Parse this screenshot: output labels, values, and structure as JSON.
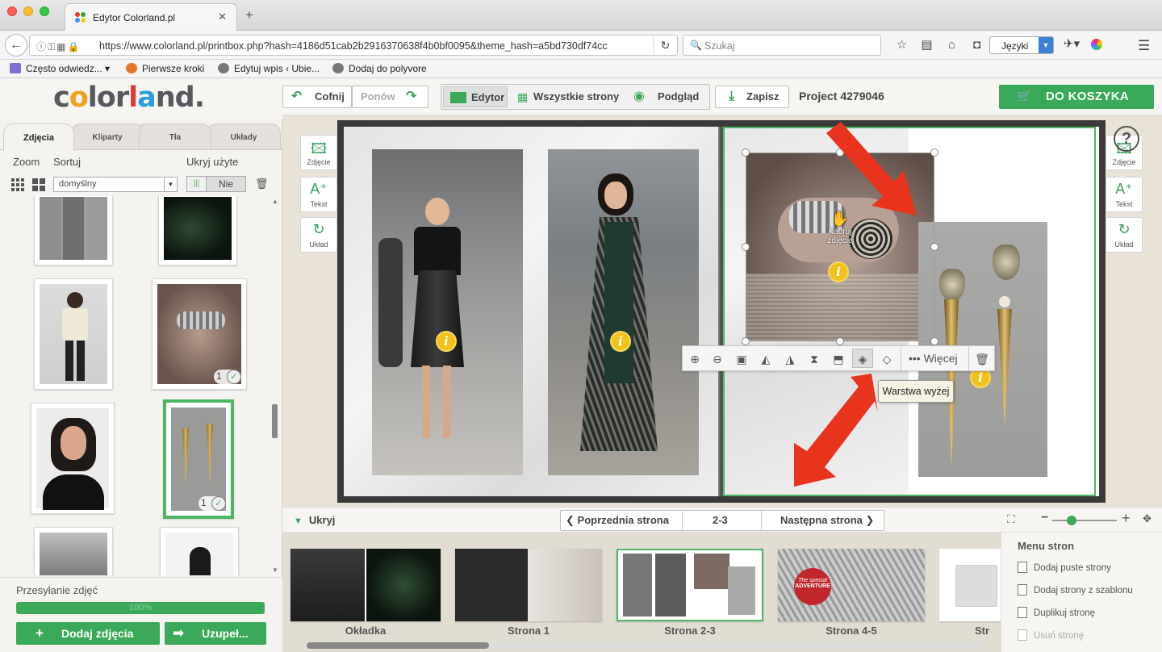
{
  "browser": {
    "tab_title": "Edytor Colorland.pl",
    "tab_close": "✕",
    "new_tab": "+",
    "url": "https://www.colorland.pl/printbox.php?hash=4186d51cab2b2916370638f4b0bf0095&theme_hash=a5bd730df74cc",
    "search_placeholder": "Szukaj",
    "language_select": "Języki",
    "bookmarks": [
      {
        "label": "Często odwiedz...",
        "icon_color": "#7b6fd6",
        "has_arrow": true
      },
      {
        "label": "Pierwsze kroki",
        "icon_color": "#e8742b"
      },
      {
        "label": "Edytuj wpis ‹ Ubie...",
        "icon_color": "#777777"
      },
      {
        "label": "Dodaj do polyvore",
        "icon_color": "#777777"
      }
    ]
  },
  "app": {
    "logo": {
      "part1": "c",
      "part2": "o",
      "part3": "lor",
      "part4": "l",
      "part5": "a",
      "part6": "nd."
    },
    "toolbar": {
      "undo": "Cofnij",
      "redo": "Ponów",
      "editor": "Edytor",
      "all_pages": "Wszystkie strony",
      "preview": "Podgląd",
      "save": "Zapisz",
      "project": "Project 4279046",
      "cart": "DO KOSZYKA"
    },
    "colors": {
      "accent": "#3aa95a",
      "selection": "#4cb665",
      "info": "#f2c21a",
      "arrow": "#e8341c"
    }
  },
  "left_panel": {
    "tabs": [
      "Zdjęcia",
      "Kliparty",
      "Tła",
      "Układy"
    ],
    "zoom_label": "Zoom",
    "sort_label": "Sortuj",
    "hide_used_label": "Ukryj użyte",
    "sort_value": "domyślny",
    "hide_used_value": "Nie",
    "thumbnails": [
      {
        "name": "street-collage",
        "used": null
      },
      {
        "name": "fern-leaves",
        "used": null
      },
      {
        "name": "woman-fringe-top",
        "used": null
      },
      {
        "name": "rings-hand",
        "used": "1"
      },
      {
        "name": "girl-portrait",
        "used": null
      },
      {
        "name": "earrings",
        "used": "1",
        "selected": true
      },
      {
        "name": "street-woman-coat",
        "used": null
      },
      {
        "name": "event-woman",
        "used": null
      }
    ],
    "upload_label": "Przesyłanie zdjęć",
    "upload_progress": 1.0,
    "upload_percent_text": "100%",
    "add_photos": "Dodaj zdjęcia",
    "fill_button": "Uzupeł..."
  },
  "canvas": {
    "left_tools": [
      {
        "name": "add-photo",
        "label": "Zdjęcie"
      },
      {
        "name": "add-text",
        "label": "Tekst"
      },
      {
        "name": "layout",
        "label": "Układ"
      }
    ],
    "right_tools": [
      {
        "name": "add-photo",
        "label": "Zdjęcie"
      },
      {
        "name": "add-text",
        "label": "Tekst"
      },
      {
        "name": "layout",
        "label": "Układ"
      }
    ],
    "help": "?",
    "crop_hint": "Kadruj\nzdjęcie",
    "context_toolbar": {
      "more": "Więcej"
    },
    "tooltip": "Warstwa wyżej"
  },
  "page_nav": {
    "hide": "Ukryj",
    "prev": "Poprzednia strona",
    "current": "2-3",
    "next": "Następna strona",
    "zoom_level": 0.2
  },
  "pages": [
    {
      "label": "Okładka"
    },
    {
      "label": "Strona 1"
    },
    {
      "label": "Strona 2-3",
      "selected": true
    },
    {
      "label": "Strona 4-5",
      "badge_line1": "The special",
      "badge_line2": "ADVENTURE"
    },
    {
      "label": "Str"
    }
  ],
  "page_menu": {
    "title": "Menu stron",
    "items": [
      {
        "label": "Dodaj puste strony",
        "enabled": true
      },
      {
        "label": "Dodaj strony z szablonu",
        "enabled": true
      },
      {
        "label": "Duplikuj stronę",
        "enabled": true
      },
      {
        "label": "Usuń stronę",
        "enabled": false
      }
    ]
  }
}
